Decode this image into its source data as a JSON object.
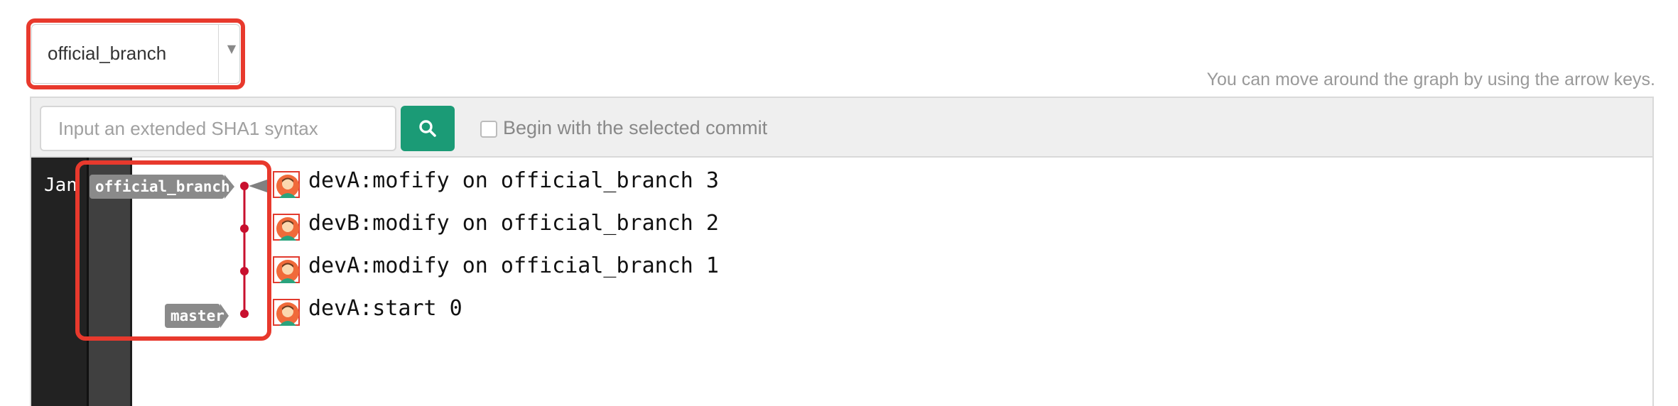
{
  "branch_selector": {
    "value": "official_branch"
  },
  "hint": "You can move around the graph by using the arrow keys.",
  "toolbar": {
    "search_placeholder": "Input an extended SHA1 syntax",
    "checkbox_label": "Begin with the selected commit"
  },
  "graph": {
    "date_label": "Jan",
    "refs": [
      "official_branch",
      "master"
    ],
    "commits": [
      {
        "message": "devA:mofify on official_branch 3"
      },
      {
        "message": "devB:modify on official_branch 2"
      },
      {
        "message": "devA:modify on official_branch 1"
      },
      {
        "message": "devA:start 0"
      }
    ]
  },
  "colors": {
    "highlight": "#e8392d",
    "search_button": "#1b9b76",
    "commit_dot": "#c8102e",
    "ref_tag": "#8a8a8a"
  }
}
